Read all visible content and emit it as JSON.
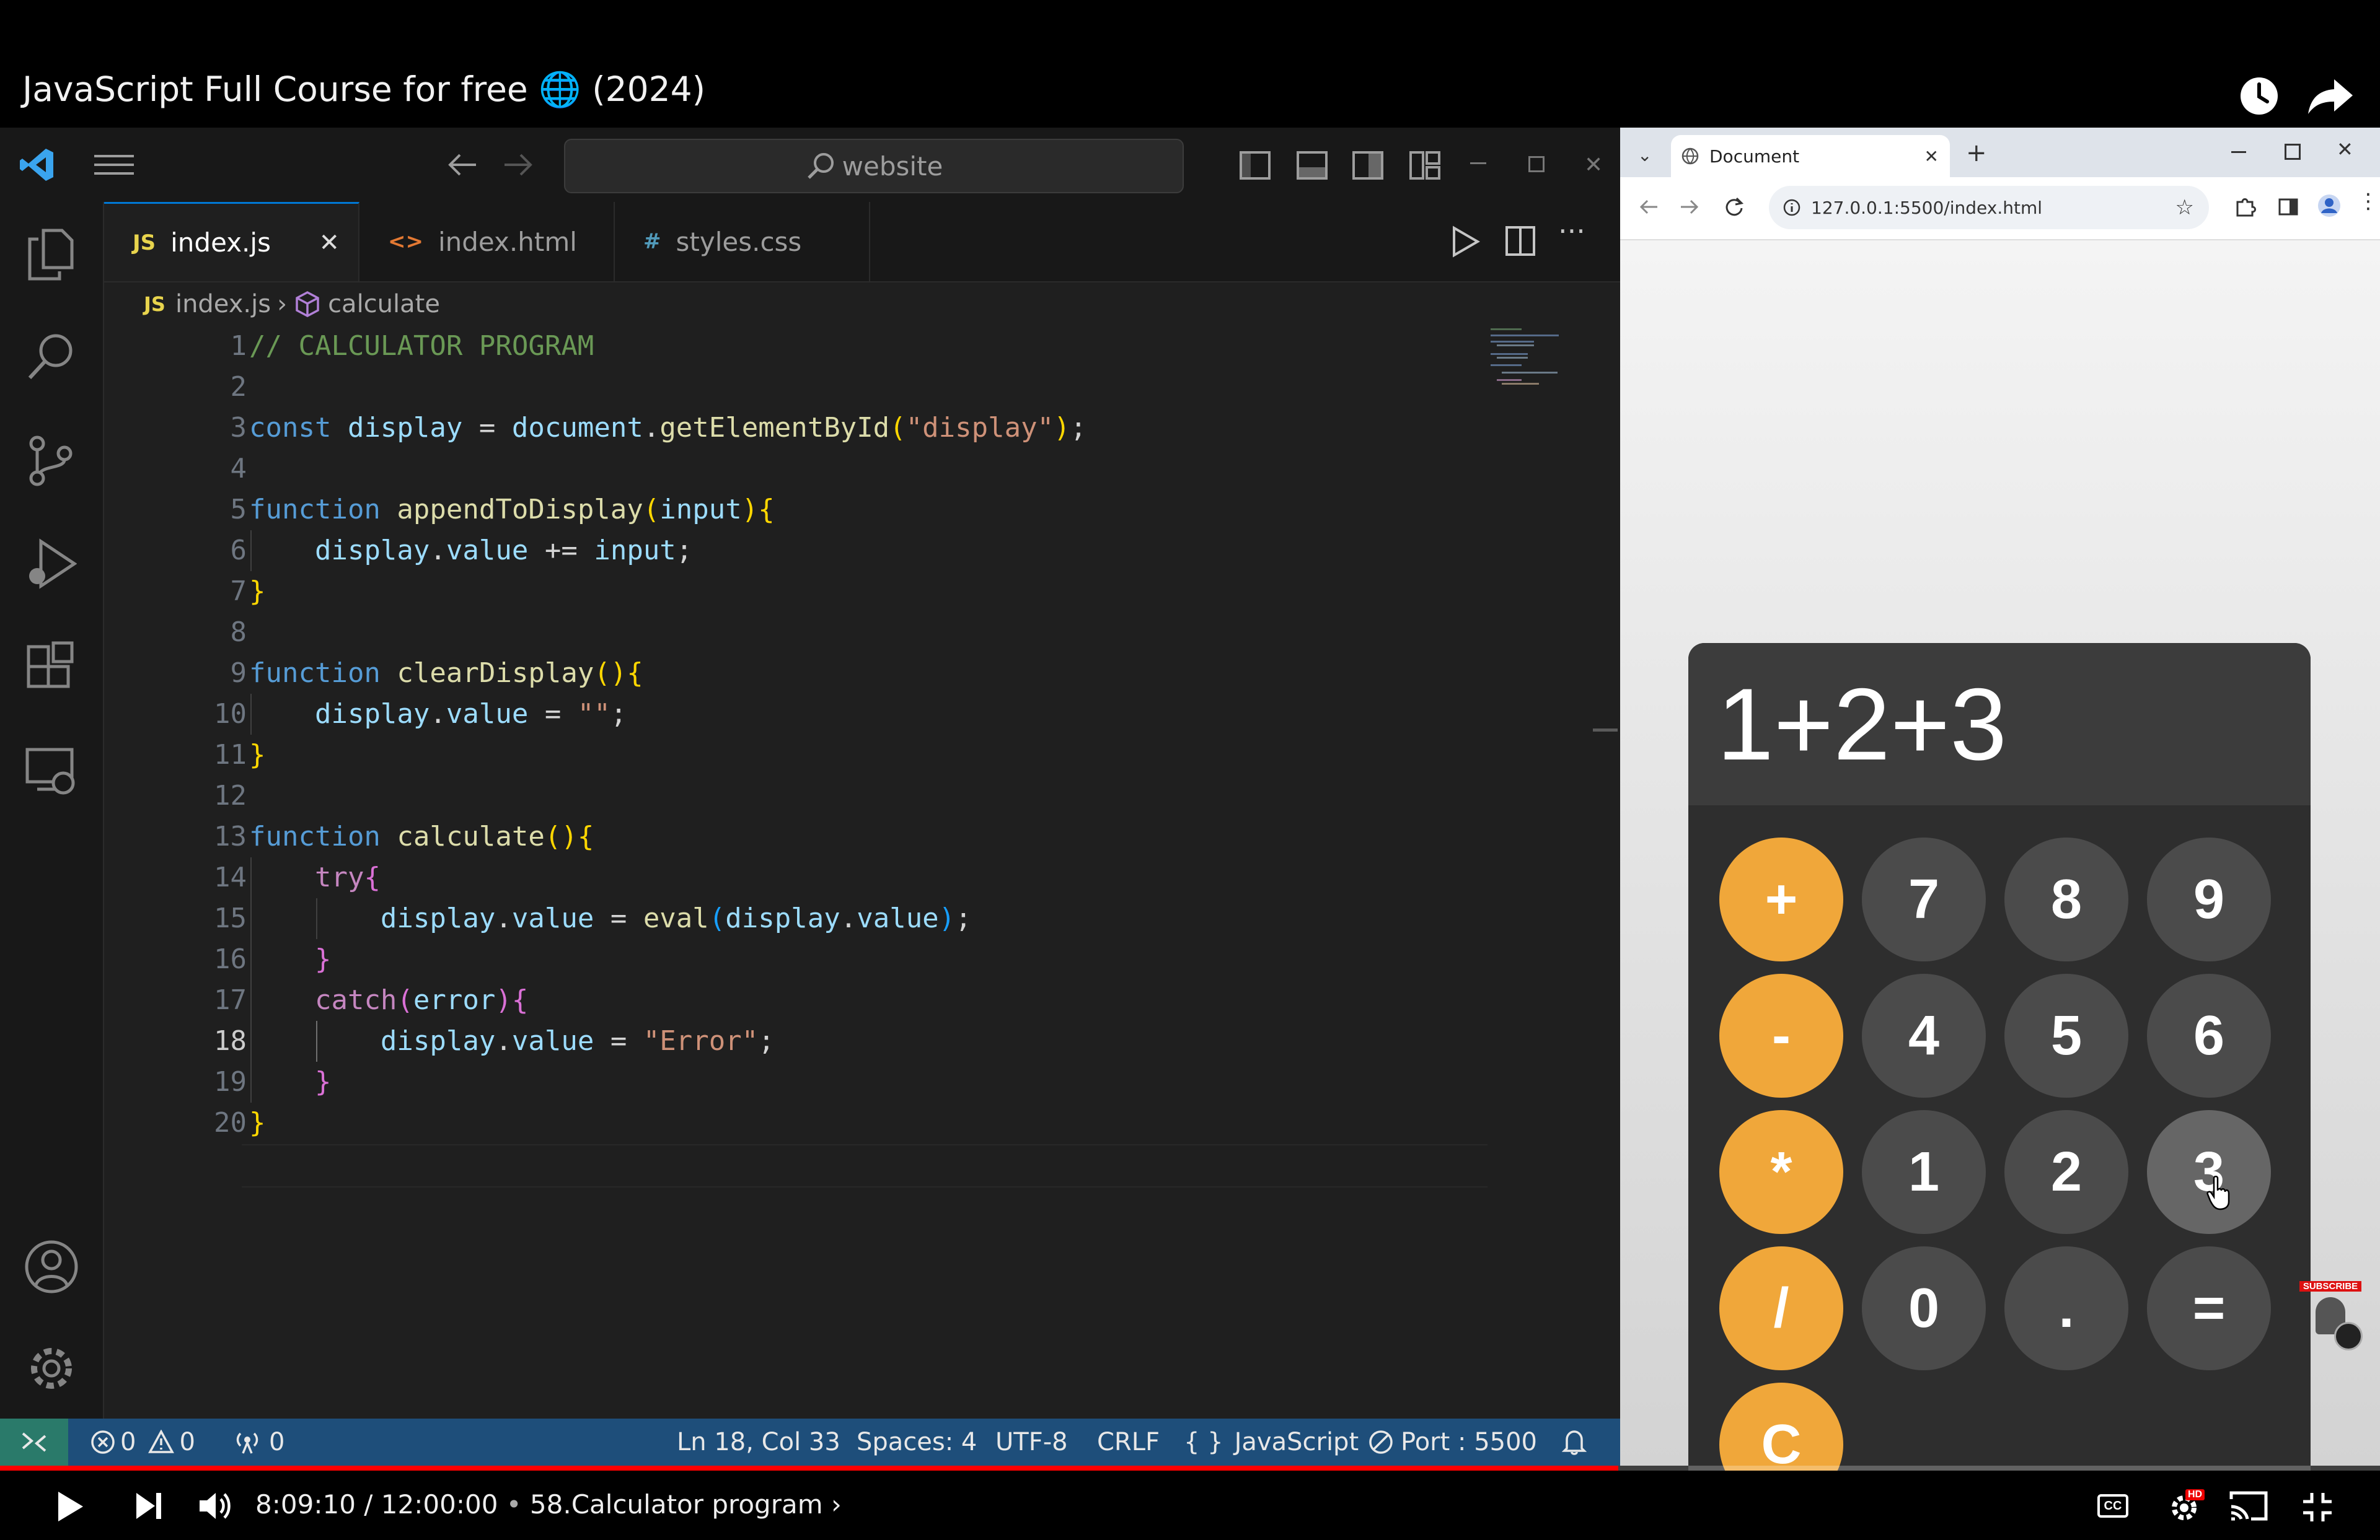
{
  "youtube": {
    "video_title": "JavaScript Full Course for free 🌐 (2024)",
    "time_current": "8:09:10",
    "time_total": "12:00:00",
    "chapter": "58.Calculator program",
    "progress": 0.68,
    "hd_badge": "HD",
    "subscribe_badge": "SUBSCRIBE",
    "accent_color": "#ff0000"
  },
  "vscode": {
    "search_placeholder": "website",
    "tabs": [
      {
        "icon": "JS",
        "label": "index.js",
        "active": true
      },
      {
        "icon": "<>",
        "label": "index.html",
        "active": false
      },
      {
        "icon": "#",
        "label": "styles.css",
        "active": false
      }
    ],
    "breadcrumb": {
      "file_icon": "JS",
      "file": "index.js",
      "symbol": "calculate"
    },
    "line_numbers": [
      "1",
      "2",
      "3",
      "4",
      "5",
      "6",
      "7",
      "8",
      "9",
      "10",
      "11",
      "12",
      "13",
      "14",
      "15",
      "16",
      "17",
      "18",
      "19",
      "20"
    ],
    "current_line": 18,
    "code": {
      "l1": "// CALCULATOR PROGRAM",
      "l3": [
        "const",
        "display",
        "=",
        "document",
        "getElementById",
        "(",
        "\"display\"",
        ");"
      ],
      "l5": [
        "function",
        "appendToDisplay",
        "(",
        "input",
        "){"
      ],
      "l6": [
        "display",
        "value",
        "+=",
        "input",
        ";"
      ],
      "l9": [
        "function",
        "clearDisplay",
        "(){"
      ],
      "l10": [
        "display",
        "value",
        "=",
        "\"\"",
        ";"
      ],
      "l13": [
        "function",
        "calculate",
        "(){"
      ],
      "l14": [
        "try",
        "{"
      ],
      "l15": [
        "display",
        "value",
        "=",
        "eval",
        "(",
        "display",
        "value",
        ");"
      ],
      "l17": [
        "catch",
        "(",
        "error",
        "){"
      ],
      "l18": [
        "display",
        "value",
        "=",
        "\"Error\"",
        ";"
      ]
    },
    "statusbar": {
      "errors": "0",
      "warnings": "0",
      "ports": "0",
      "position": "Ln 18, Col 33",
      "spaces": "Spaces: 4",
      "encoding": "UTF-8",
      "eol": "CRLF",
      "language_icon": "{ }",
      "language": "JavaScript",
      "port": "Port : 5500"
    },
    "colors": {
      "statusbar": "#1e4e7a",
      "accent": "#0078d4",
      "keyword": "#569cd6",
      "function": "#dcdcaa",
      "variable": "#9cdcfe",
      "string": "#ce9178",
      "comment": "#6a9955"
    }
  },
  "browser": {
    "tab_title": "Document",
    "url": "127.0.0.1:5500/index.html"
  },
  "calculator": {
    "display": "1+2+3",
    "keys": [
      {
        "label": "+",
        "type": "op"
      },
      {
        "label": "7",
        "type": "num"
      },
      {
        "label": "8",
        "type": "num"
      },
      {
        "label": "9",
        "type": "num"
      },
      {
        "label": "-",
        "type": "op"
      },
      {
        "label": "4",
        "type": "num"
      },
      {
        "label": "5",
        "type": "num"
      },
      {
        "label": "6",
        "type": "num"
      },
      {
        "label": "*",
        "type": "op"
      },
      {
        "label": "1",
        "type": "num"
      },
      {
        "label": "2",
        "type": "num"
      },
      {
        "label": "3",
        "type": "num",
        "hover": true
      },
      {
        "label": "/",
        "type": "op"
      },
      {
        "label": "0",
        "type": "num"
      },
      {
        "label": ".",
        "type": "num"
      },
      {
        "label": "=",
        "type": "num"
      },
      {
        "label": "C",
        "type": "op"
      }
    ],
    "colors": {
      "operator": "#f0a73a",
      "number": "#4b4b4b",
      "body": "#2e2e2e",
      "display_bg": "#3c3c3c"
    }
  }
}
